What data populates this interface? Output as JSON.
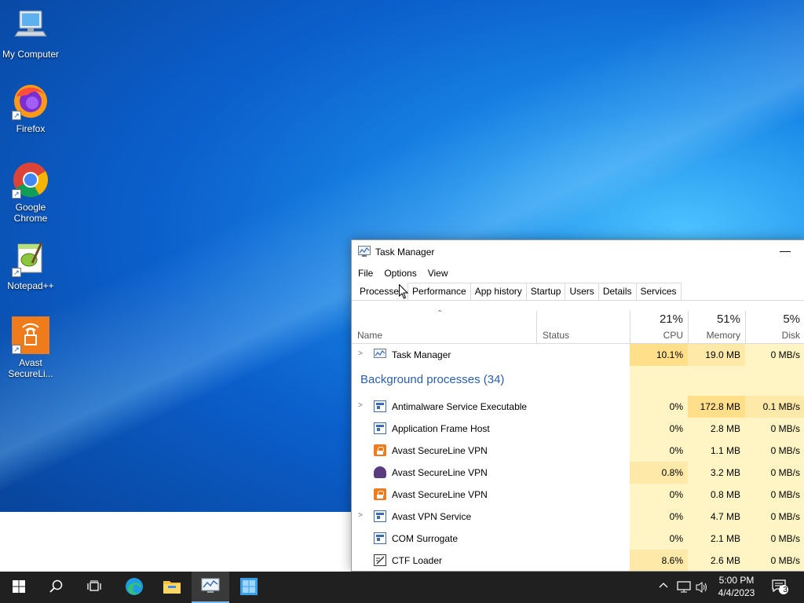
{
  "desktop": {
    "icons": [
      {
        "label": "My Computer",
        "icon": "computer-icon"
      },
      {
        "label": "Firefox",
        "icon": "firefox-icon"
      },
      {
        "label": "Google Chrome",
        "icon": "chrome-icon"
      },
      {
        "label": "Notepad++",
        "icon": "notepadpp-icon"
      },
      {
        "label": "Avast SecureLi...",
        "icon": "avast-vpn-icon"
      }
    ]
  },
  "task_manager": {
    "title": "Task Manager",
    "minimize_glyph": "—",
    "menu": [
      "File",
      "Options",
      "View"
    ],
    "tabs": [
      "Processes",
      "Performance",
      "App history",
      "Startup",
      "Users",
      "Details",
      "Services"
    ],
    "active_tab": "Processes",
    "columns": {
      "name": "Name",
      "status": "Status",
      "cpu": {
        "percent": "21%",
        "label": "CPU"
      },
      "memory": {
        "percent": "51%",
        "label": "Memory"
      },
      "disk": {
        "percent": "5%",
        "label": "Disk"
      }
    },
    "apps": [
      {
        "name": "Task Manager",
        "cpu": "10.1%",
        "memory": "19.0 MB",
        "disk": "0 MB/s",
        "expandable": true,
        "icon": "task-manager-icon"
      }
    ],
    "background_group": "Background processes (34)",
    "processes": [
      {
        "name": "Antimalware Service Executable",
        "cpu": "0%",
        "memory": "172.8 MB",
        "disk": "0.1 MB/s",
        "expandable": true,
        "icon": "app-window-icon"
      },
      {
        "name": "Application Frame Host",
        "cpu": "0%",
        "memory": "2.8 MB",
        "disk": "0 MB/s",
        "expandable": false,
        "icon": "app-window-icon"
      },
      {
        "name": "Avast SecureLine VPN",
        "cpu": "0%",
        "memory": "1.1 MB",
        "disk": "0 MB/s",
        "expandable": false,
        "icon": "avast-lock-icon"
      },
      {
        "name": "Avast SecureLine VPN",
        "cpu": "0.8%",
        "memory": "3.2 MB",
        "disk": "0 MB/s",
        "expandable": false,
        "icon": "avast-secureline-icon"
      },
      {
        "name": "Avast SecureLine VPN",
        "cpu": "0%",
        "memory": "0.8 MB",
        "disk": "0 MB/s",
        "expandable": false,
        "icon": "avast-lock-icon"
      },
      {
        "name": "Avast VPN Service",
        "cpu": "0%",
        "memory": "4.7 MB",
        "disk": "0 MB/s",
        "expandable": true,
        "icon": "app-window-icon"
      },
      {
        "name": "COM Surrogate",
        "cpu": "0%",
        "memory": "2.1 MB",
        "disk": "0 MB/s",
        "expandable": false,
        "icon": "app-window-icon"
      },
      {
        "name": "CTF Loader",
        "cpu": "8.6%",
        "memory": "2.6 MB",
        "disk": "0 MB/s",
        "expandable": false,
        "icon": "ctf-loader-icon"
      }
    ]
  },
  "taskbar": {
    "buttons": [
      "start-icon",
      "search-icon",
      "task-view-icon",
      "edge-icon",
      "file-explorer-icon",
      "task-manager-icon",
      "windows-app-icon"
    ],
    "clock": {
      "time": "5:00 PM",
      "date": "4/4/2023"
    },
    "notifications_count": "3"
  }
}
